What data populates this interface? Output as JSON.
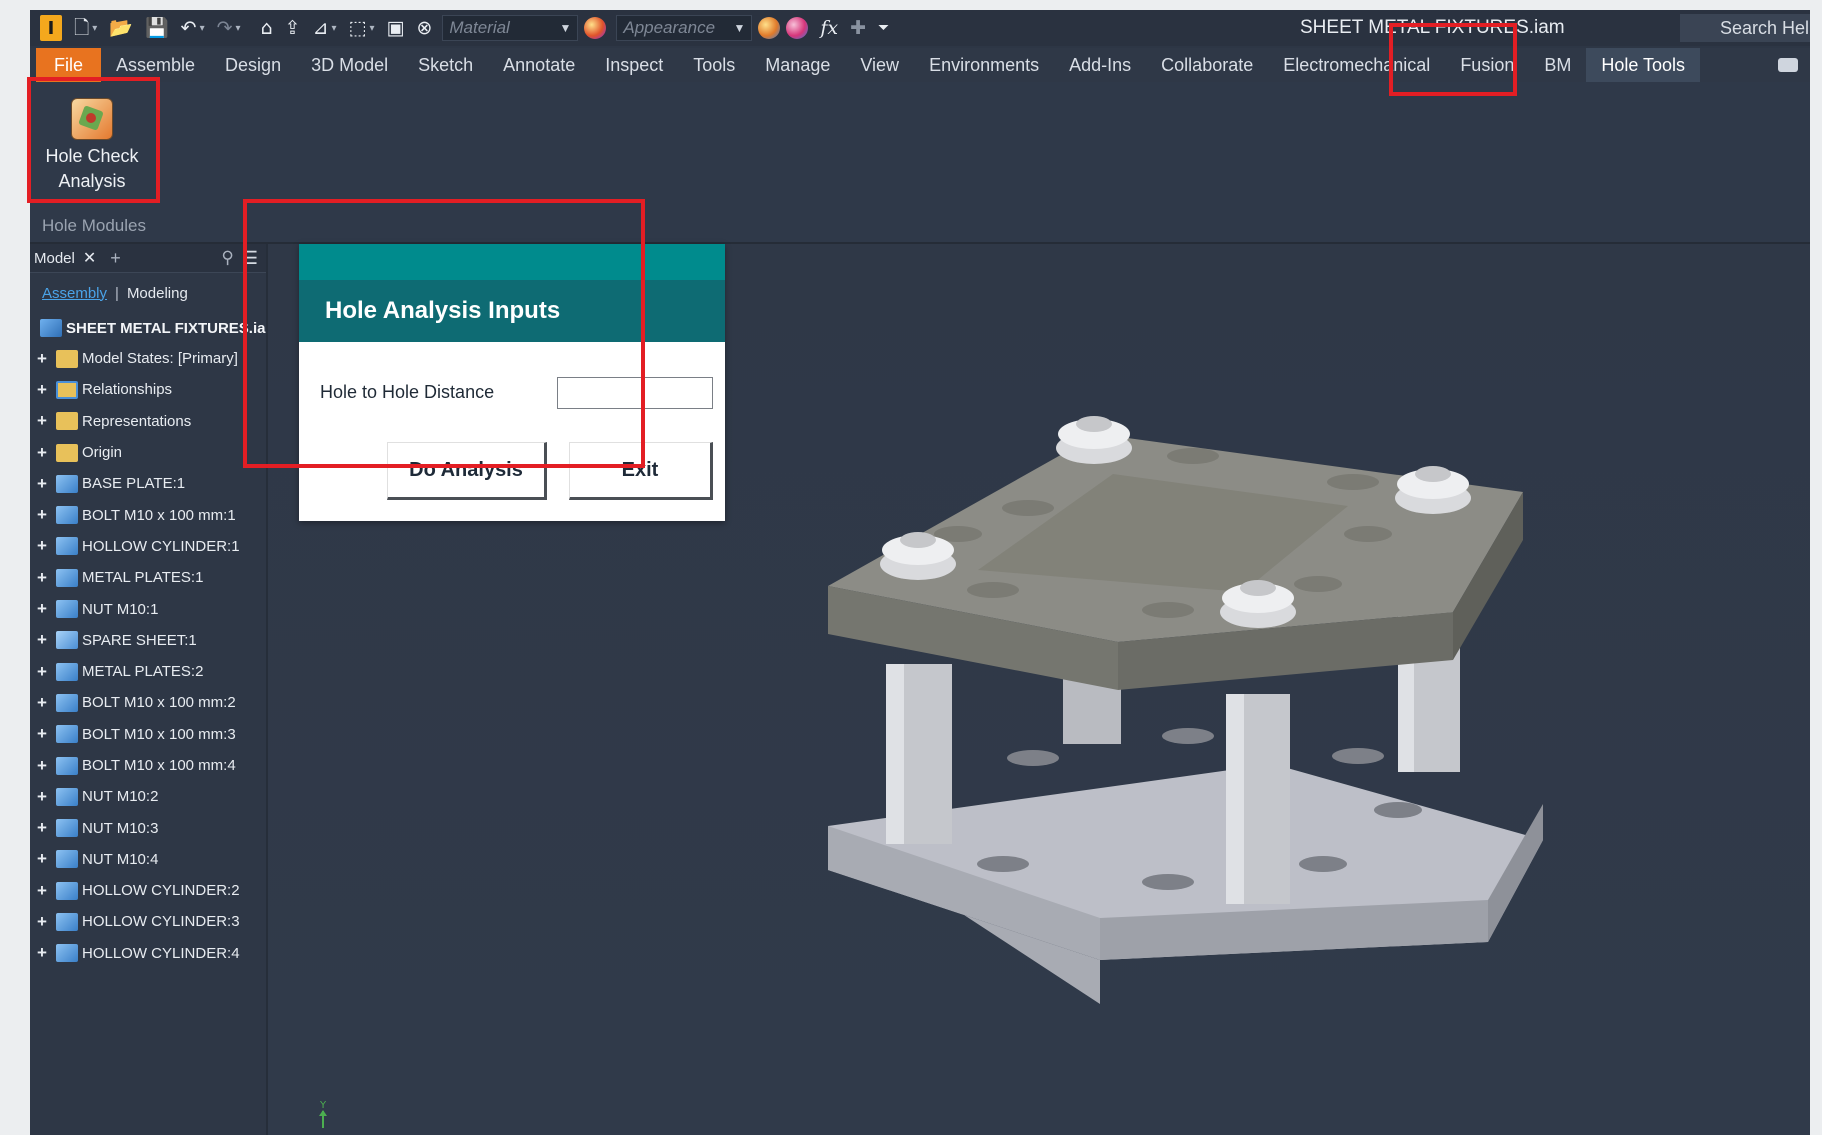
{
  "window": {
    "document_title": "SHEET METAL FIXTURES.iam",
    "search": "Search Help &"
  },
  "quick_access": {
    "material_placeholder": "Material",
    "appearance_placeholder": "Appearance",
    "fx_label": "fx"
  },
  "ribbon": {
    "tabs": [
      "File",
      "Assemble",
      "Design",
      "3D Model",
      "Sketch",
      "Annotate",
      "Inspect",
      "Tools",
      "Manage",
      "View",
      "Environments",
      "Add-Ins",
      "Collaborate",
      "Electromechanical",
      "Fusion",
      "BM",
      "Hole Tools"
    ],
    "active_tab": "Hole Tools",
    "button_line1": "Hole Check",
    "button_line2": "Analysis",
    "panel_name": "Hole Modules"
  },
  "browser": {
    "title": "Model",
    "view_assembly": "Assembly",
    "view_modeling": "Modeling",
    "root": "SHEET METAL FIXTURES.iam",
    "items": [
      {
        "label": "Model States: [Primary]",
        "icon": "folder-icon"
      },
      {
        "label": "Relationships",
        "icon": "relationships-icon"
      },
      {
        "label": "Representations",
        "icon": "representations-icon"
      },
      {
        "label": "Origin",
        "icon": "origin-icon"
      },
      {
        "label": "BASE PLATE:1",
        "icon": "part-icon"
      },
      {
        "label": "BOLT M10 x 100 mm:1",
        "icon": "part-icon"
      },
      {
        "label": "HOLLOW CYLINDER:1",
        "icon": "part-icon"
      },
      {
        "label": "METAL PLATES:1",
        "icon": "part-icon"
      },
      {
        "label": "NUT M10:1",
        "icon": "part-icon"
      },
      {
        "label": "SPARE SHEET:1",
        "icon": "sheet-metal-icon"
      },
      {
        "label": "METAL PLATES:2",
        "icon": "part-icon"
      },
      {
        "label": "BOLT M10 x 100 mm:2",
        "icon": "part-icon"
      },
      {
        "label": "BOLT M10 x 100 mm:3",
        "icon": "part-icon"
      },
      {
        "label": "BOLT M10 x 100 mm:4",
        "icon": "part-icon"
      },
      {
        "label": "NUT M10:2",
        "icon": "part-icon"
      },
      {
        "label": "NUT M10:3",
        "icon": "part-icon"
      },
      {
        "label": "NUT M10:4",
        "icon": "part-icon"
      },
      {
        "label": "HOLLOW CYLINDER:2",
        "icon": "part-icon"
      },
      {
        "label": "HOLLOW CYLINDER:3",
        "icon": "part-icon"
      },
      {
        "label": "HOLLOW CYLINDER:4",
        "icon": "part-icon"
      }
    ]
  },
  "dialog": {
    "title": "Hole Analysis Inputs",
    "field_label": "Hole to Hole Distance",
    "field_value": "",
    "do_analysis": "Do Analysis",
    "exit": "Exit"
  },
  "viewport": {
    "axis_label": "Y"
  },
  "colors": {
    "highlight": "#e31e24",
    "file_tab": "#e8731f",
    "dialog_header": "#0e6b73",
    "dialog_strip": "#008b8d"
  }
}
